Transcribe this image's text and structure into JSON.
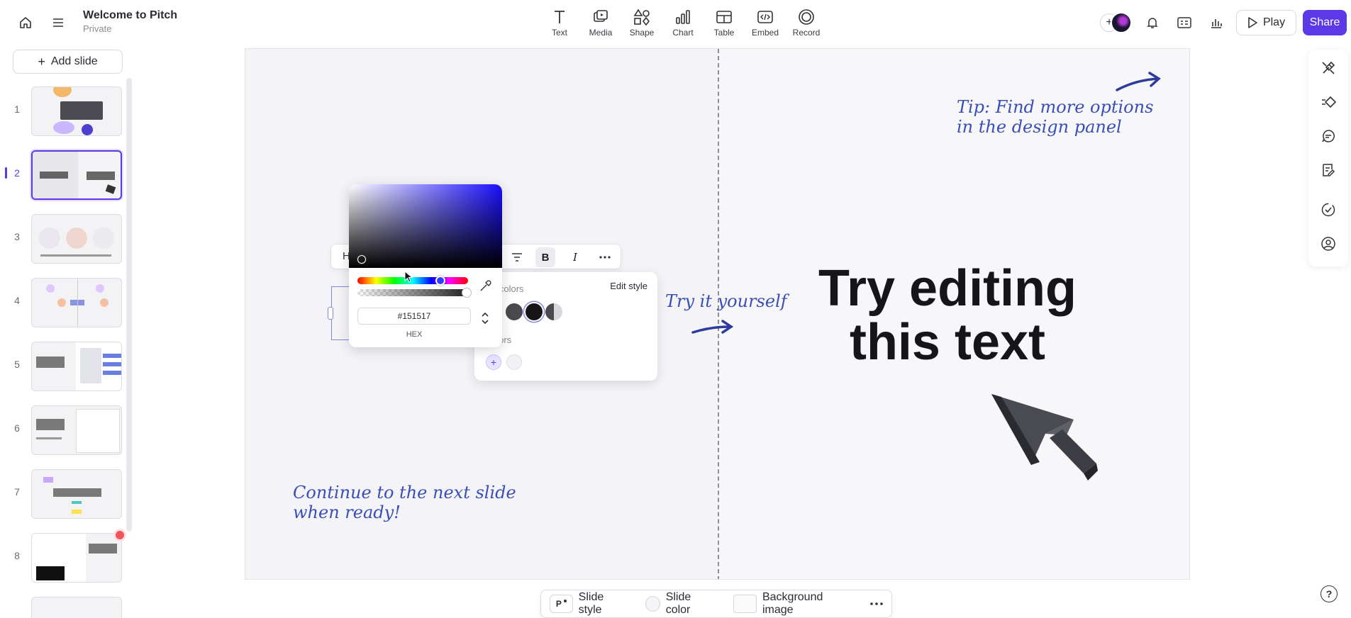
{
  "header": {
    "title": "Welcome to Pitch",
    "subtitle": "Private",
    "play_label": "Play",
    "share_label": "Share"
  },
  "toolbar": {
    "items": [
      {
        "label": "Text",
        "icon": "text-icon"
      },
      {
        "label": "Media",
        "icon": "media-icon"
      },
      {
        "label": "Shape",
        "icon": "shape-icon"
      },
      {
        "label": "Chart",
        "icon": "chart-icon"
      },
      {
        "label": "Table",
        "icon": "table-icon"
      },
      {
        "label": "Embed",
        "icon": "embed-icon"
      },
      {
        "label": "Record",
        "icon": "record-icon"
      }
    ]
  },
  "sidebar": {
    "add_slide_label": "Add slide",
    "slides": [
      {
        "number": "1",
        "active": false
      },
      {
        "number": "2",
        "active": true
      },
      {
        "number": "3",
        "active": false
      },
      {
        "number": "4",
        "active": false
      },
      {
        "number": "5",
        "active": false
      },
      {
        "number": "6",
        "active": false
      },
      {
        "number": "7",
        "active": false
      },
      {
        "number": "8",
        "active": false
      }
    ]
  },
  "slide": {
    "tip": "Tip: Find more options in the design panel",
    "try_yourself": "Try it yourself",
    "continue": "Continue to the next slide when ready!",
    "headline_line1": "Try editing",
    "headline_line2": "this text"
  },
  "text_toolbar": {
    "heading_label": "H",
    "bold_label": "B",
    "italic_label": "I"
  },
  "colors_panel": {
    "section1_label": "e colors",
    "edit_style_label": "Edit style",
    "section2_label": "olors",
    "swatches": [
      "#4a4a4e",
      "#151517",
      "#6b6b70"
    ]
  },
  "color_picker": {
    "hex_value": "#151517",
    "mode_label": "HEX"
  },
  "bottom_bar": {
    "slide_style_label": "Slide style",
    "slide_style_badge": "P",
    "slide_color_label": "Slide color",
    "background_image_label": "Background image"
  },
  "colors": {
    "accent": "#5b39e6",
    "handwriting": "#3a4fb6"
  }
}
